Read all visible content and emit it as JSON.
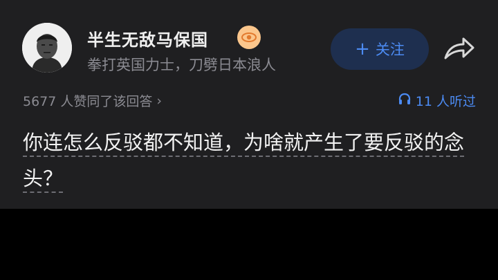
{
  "author": {
    "name": "半生无敌马保国",
    "bio": "拳打英国力士，刀劈日本浪人",
    "badge_icon": "eye-badge-icon"
  },
  "actions": {
    "follow_label": "关注",
    "follow_icon": "plus-icon",
    "share_icon": "share-arrow-icon"
  },
  "stats": {
    "likes_text": "5677 人赞同了该回答",
    "likes_chevron": "›",
    "listeners_text": "11 人听过",
    "listen_icon": "headphones-icon"
  },
  "answer": {
    "text": "你连怎么反驳都不知道，为啥就产生了要反驳的念头？"
  },
  "colors": {
    "card_bg": "#1f1f21",
    "accent_blue": "#4c8bf3",
    "follow_bg": "#1e2f4f",
    "badge": "#fbc68c",
    "muted": "#8b8b92",
    "text": "#f2f2f2"
  }
}
